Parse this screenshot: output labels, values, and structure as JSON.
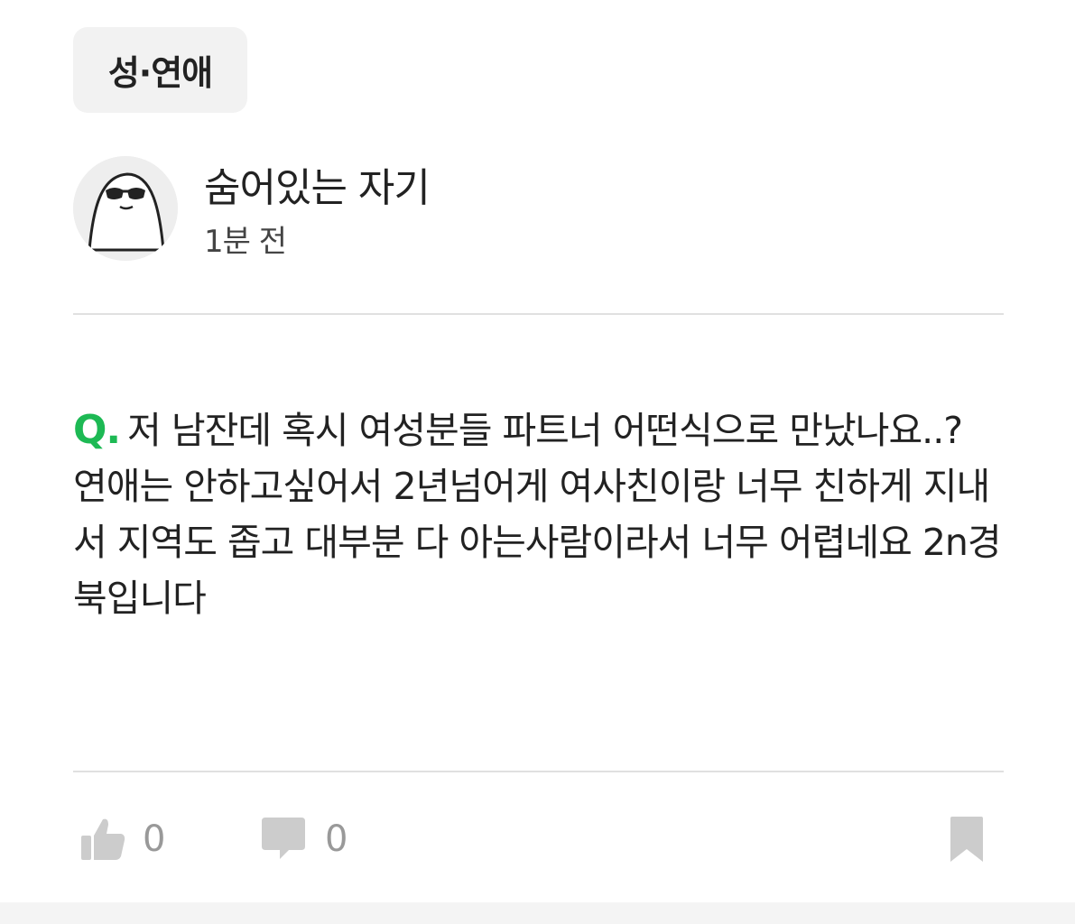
{
  "category": "성·연애",
  "author": {
    "name": "숨어있는 자기",
    "time": "1분 전"
  },
  "question": {
    "prefix": "Q.",
    "text": "저 남잔데 혹시 여성분들 파트너 어떤식으로 만났나요..?\n연애는 안하고싶어서 2년넘어게 여사친이랑 너무 친하게 지내서 지역도 좁고 대부분 다 아는사람이라서 너무 어렵네요 2n경북입니다"
  },
  "actions": {
    "like_icon": "thumbs-up-icon",
    "like_count": "0",
    "comment_icon": "speech-bubble-icon",
    "comment_count": "0",
    "bookmark_icon": "bookmark-icon"
  },
  "colors": {
    "accent_green": "#1db954",
    "icon_gray": "#cccccc",
    "chip_bg": "#f2f2f2"
  }
}
